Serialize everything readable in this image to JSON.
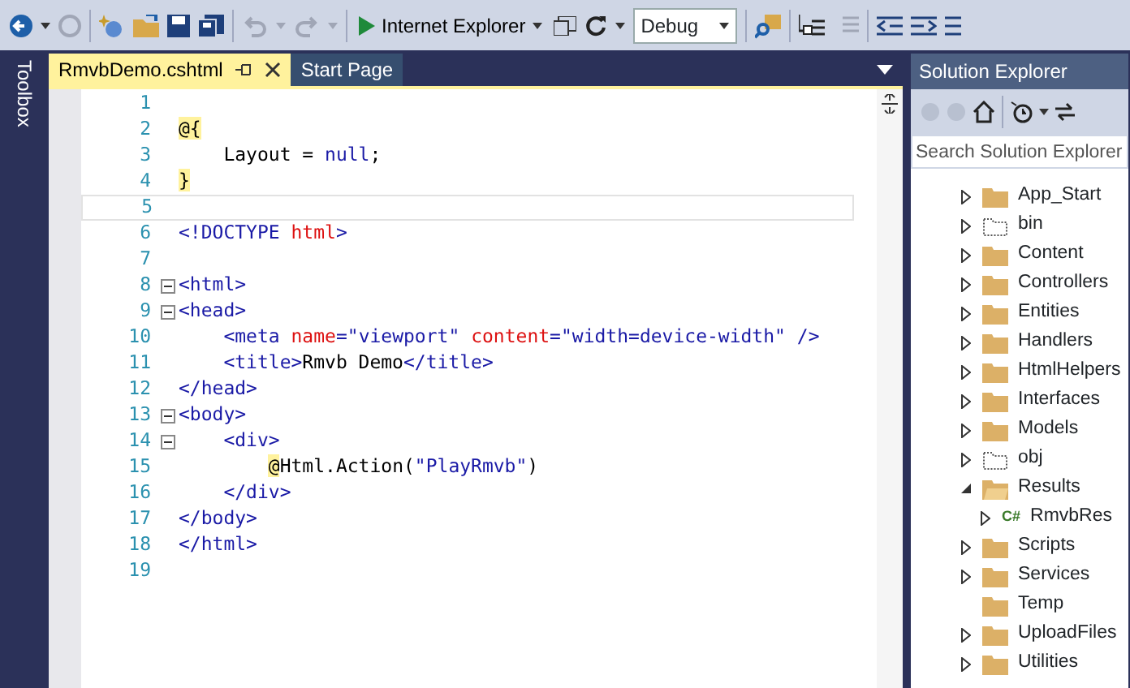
{
  "toolbar": {
    "run_target": "Internet Explorer",
    "configuration": "Debug"
  },
  "toolbox_label": "Toolbox",
  "tabs": [
    {
      "label": "RmvbDemo.cshtml",
      "selected": true
    },
    {
      "label": "Start Page",
      "selected": false
    }
  ],
  "editor": {
    "lines": [
      {
        "number": "1"
      },
      {
        "number": "2",
        "segments": [
          {
            "text": "@{",
            "kind": "razor"
          }
        ]
      },
      {
        "number": "3",
        "segments": [
          {
            "text": "    Layout = ",
            "kind": "code"
          },
          {
            "text": "null",
            "kind": "keyword"
          },
          {
            "text": ";",
            "kind": "code"
          }
        ]
      },
      {
        "number": "4",
        "segments": [
          {
            "text": "}",
            "kind": "razor"
          }
        ]
      },
      {
        "number": "5",
        "current": true
      },
      {
        "number": "6",
        "segments": [
          {
            "text": "<!DOCTYPE ",
            "kind": "tag"
          },
          {
            "text": "html",
            "kind": "attr"
          },
          {
            "text": ">",
            "kind": "tag"
          }
        ]
      },
      {
        "number": "7"
      },
      {
        "number": "8",
        "collapsible": true,
        "segments": [
          {
            "text": "<html>",
            "kind": "tag"
          }
        ]
      },
      {
        "number": "9",
        "collapsible": true,
        "segments": [
          {
            "text": "<head>",
            "kind": "tag"
          }
        ]
      },
      {
        "number": "10",
        "segments": [
          {
            "text": "    <meta ",
            "kind": "tag"
          },
          {
            "text": "name",
            "kind": "attr"
          },
          {
            "text": "=",
            "kind": "tag"
          },
          {
            "text": "\"viewport\"",
            "kind": "value"
          },
          {
            "text": " content",
            "kind": "attr"
          },
          {
            "text": "=",
            "kind": "tag"
          },
          {
            "text": "\"width=device-width\"",
            "kind": "value"
          },
          {
            "text": " />",
            "kind": "tag"
          }
        ]
      },
      {
        "number": "11",
        "segments": [
          {
            "text": "    <title>",
            "kind": "tag"
          },
          {
            "text": "Rmvb Demo",
            "kind": "code"
          },
          {
            "text": "</title>",
            "kind": "tag"
          }
        ]
      },
      {
        "number": "12",
        "segments": [
          {
            "text": "</head>",
            "kind": "tag"
          }
        ]
      },
      {
        "number": "13",
        "collapsible": true,
        "segments": [
          {
            "text": "<body>",
            "kind": "tag"
          }
        ]
      },
      {
        "number": "14",
        "collapsible": true,
        "segments": [
          {
            "text": "    <div>",
            "kind": "tag"
          }
        ]
      },
      {
        "number": "15",
        "segments": [
          {
            "text": "        @",
            "kind": "razor"
          },
          {
            "text": "Html.Action(",
            "kind": "code"
          },
          {
            "text": "\"PlayRmvb\"",
            "kind": "value"
          },
          {
            "text": ")",
            "kind": "code"
          }
        ]
      },
      {
        "number": "16",
        "segments": [
          {
            "text": "    </div>",
            "kind": "tag"
          }
        ]
      },
      {
        "number": "17",
        "segments": [
          {
            "text": "</body>",
            "kind": "tag"
          }
        ]
      },
      {
        "number": "18",
        "segments": [
          {
            "text": "</html>",
            "kind": "tag"
          }
        ]
      },
      {
        "number": "19"
      }
    ]
  },
  "solution_explorer": {
    "title": "Solution Explorer",
    "search": {
      "placeholder": "Search Solution Explorer"
    },
    "items": [
      {
        "label": "App_Start",
        "kind": "folder",
        "expanded": false
      },
      {
        "label": "bin",
        "kind": "hidden",
        "expanded": false
      },
      {
        "label": "Content",
        "kind": "folder",
        "expanded": false
      },
      {
        "label": "Controllers",
        "kind": "folder",
        "expanded": false
      },
      {
        "label": "Entities",
        "kind": "folder",
        "expanded": false
      },
      {
        "label": "Handlers",
        "kind": "folder",
        "expanded": false
      },
      {
        "label": "HtmlHelpers",
        "kind": "folder",
        "expanded": false
      },
      {
        "label": "Interfaces",
        "kind": "folder",
        "expanded": false
      },
      {
        "label": "Models",
        "kind": "folder",
        "expanded": false
      },
      {
        "label": "obj",
        "kind": "hidden",
        "expanded": false
      },
      {
        "label": "Results",
        "kind": "folder",
        "expanded": true,
        "children": [
          {
            "label": "RmvbRes",
            "badge": "C#",
            "expanded": false
          }
        ]
      },
      {
        "label": "Scripts",
        "kind": "folder",
        "expanded": false
      },
      {
        "label": "Services",
        "kind": "folder",
        "expanded": false
      },
      {
        "label": "Temp",
        "kind": "folder"
      },
      {
        "label": "UploadFiles",
        "kind": "folder",
        "expanded": false
      },
      {
        "label": "Utilities",
        "kind": "folder",
        "expanded": false
      }
    ]
  }
}
